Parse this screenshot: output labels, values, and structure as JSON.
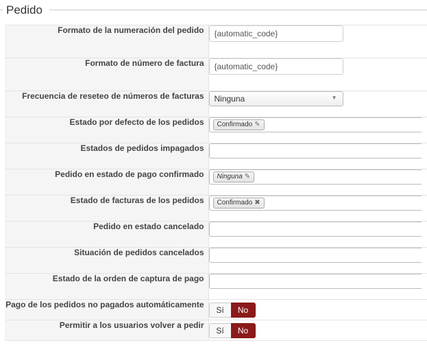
{
  "section": {
    "title": "Pedido"
  },
  "fields": [
    {
      "label": "Formato de la numeración del pedido",
      "value": "{automatic_code}"
    },
    {
      "label": "Formato de número de factura",
      "value": "{automatic_code}"
    },
    {
      "label": "Frecuencia de reseteo de números de facturas",
      "selected": "Ninguna"
    },
    {
      "label": "Estado por defecto de los pedidos",
      "chip": "Confirmado",
      "chip_icon": "pencil-icon"
    },
    {
      "label": "Estados de pedidos impagados"
    },
    {
      "label": "Pedido en estado de pago confirmado",
      "chip": "Ninguna",
      "chip_icon": "pencil-icon"
    },
    {
      "label": "Estado de facturas de los pedidos",
      "chip": "Confirmado",
      "chip_icon": "remove-x-icon"
    },
    {
      "label": "Pedido en estado cancelado"
    },
    {
      "label": "Situación de pedidos cancelados"
    },
    {
      "label": "Estado de la orden de captura de pago"
    },
    {
      "label": "Pago de los pedidos no pagados automáticamente",
      "yes": "Sí",
      "no": "No",
      "state": "No"
    },
    {
      "label": "Permitir a los usuarios volver a pedir",
      "yes": "Sí",
      "no": "No",
      "state": "No"
    }
  ],
  "colors": {
    "toggle_active": "#8b1a1a",
    "label_bg": "#f5f5f5"
  }
}
